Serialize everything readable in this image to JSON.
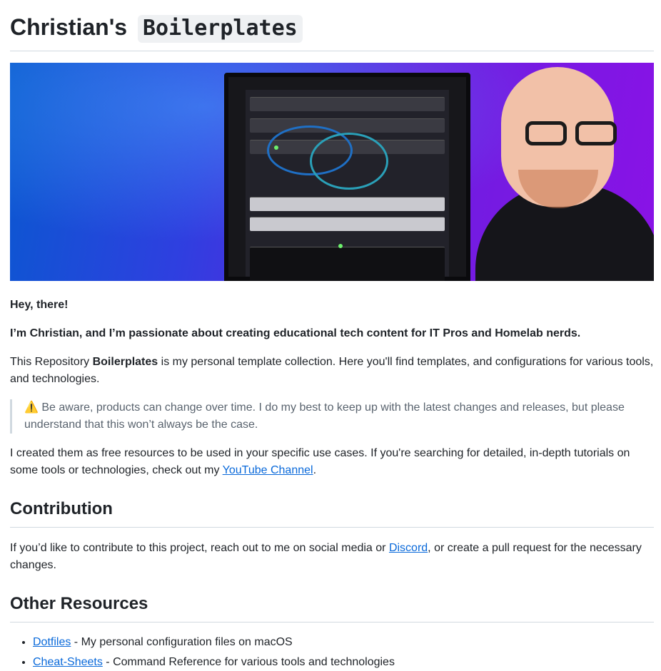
{
  "header": {
    "title_prefix": "Christian's",
    "title_code": "Boilerplates"
  },
  "hero_image": {
    "description_icon": "homelab-rack-banner"
  },
  "intro": {
    "greeting": "Hey, there!",
    "tagline": "I’m Christian, and I’m passionate about creating educational tech content for IT Pros and Homelab nerds.",
    "repo_prefix": "This Repository ",
    "repo_name": "Boilerplates",
    "repo_suffix": " is my personal template collection. Here you'll find templates, and configurations for various tools, and technologies."
  },
  "notice": {
    "icon": "⚠️",
    "text": " Be aware, products can change over time. I do my best to keep up with the latest changes and releases, but please understand that this won’t always be the case."
  },
  "free": {
    "text_before": "I created them as free resources to be used in your specific use cases. If you're searching for detailed, in-depth tutorials on some tools or technologies, check out my ",
    "link_label": "YouTube Channel",
    "text_after": "."
  },
  "contribution": {
    "heading": "Contribution",
    "text_before": "If you’d like to contribute to this project, reach out to me on social media or ",
    "link_label": "Discord",
    "text_after": ", or create a pull request for the necessary changes."
  },
  "other_resources": {
    "heading": "Other Resources",
    "items": [
      {
        "link": "Dotfiles",
        "description": " - My personal configuration files on macOS"
      },
      {
        "link": "Cheat-Sheets",
        "description": " - Command Reference for various tools and technologies"
      }
    ]
  },
  "colors": {
    "link": "#0969da",
    "text": "#1f2328",
    "muted": "#59636e",
    "border": "#d1d9e0"
  }
}
